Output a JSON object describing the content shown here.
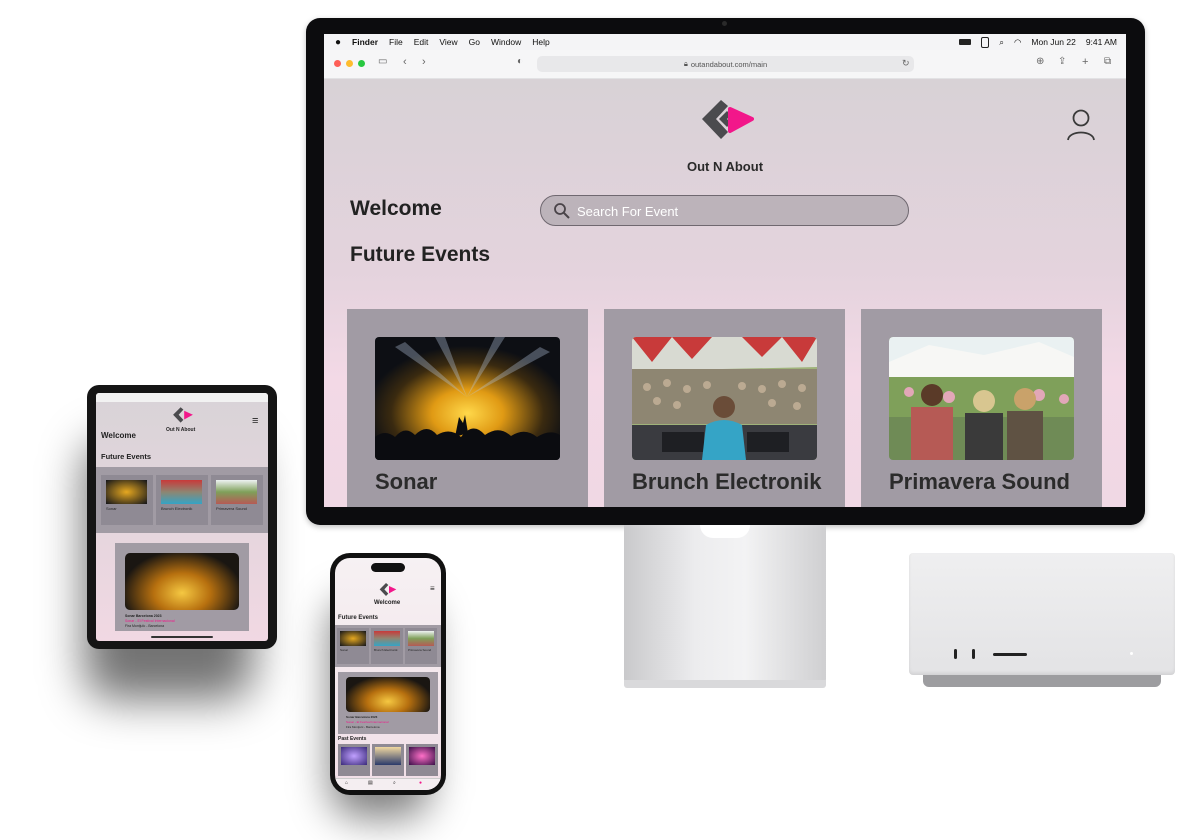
{
  "menubar": {
    "app": "Finder",
    "items": [
      "File",
      "Edit",
      "View",
      "Go",
      "Window",
      "Help"
    ],
    "date": "Mon Jun 22",
    "time": "9:41 AM"
  },
  "browser": {
    "url": "outandabout.com/main"
  },
  "site": {
    "brand": "Out N About",
    "welcome": "Welcome",
    "search_placeholder": "Search For Event",
    "future_heading": "Future Events",
    "past_heading": "Past Events",
    "events": [
      {
        "title": "Sonar"
      },
      {
        "title": "Brunch Electronik"
      },
      {
        "title": "Primavera Sound"
      }
    ],
    "featured": {
      "title": "Sonar Barcelona 2023",
      "subtitle": "Sonar - El Festival Internacional",
      "location": "Fira Montjuïc - Barcelona"
    }
  },
  "colors": {
    "brand_pink": "#f2178a",
    "logo_grey": "#4b4b4e",
    "card_bg": "#a19ba4"
  },
  "icons": {
    "avatar": "user-outline-icon",
    "search": "magnifier-icon",
    "menu": "hamburger-icon"
  }
}
